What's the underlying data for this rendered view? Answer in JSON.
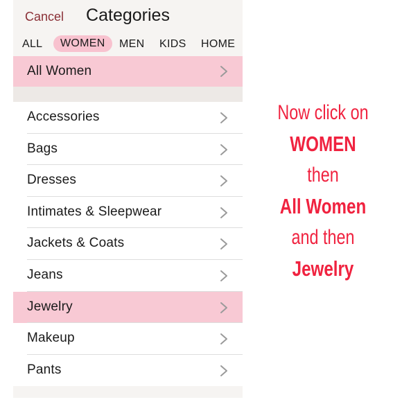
{
  "header": {
    "cancel_label": "Cancel",
    "title": "Categories"
  },
  "tabs": [
    {
      "label": "ALL",
      "selected": false
    },
    {
      "label": "WOMEN",
      "selected": true
    },
    {
      "label": "MEN",
      "selected": false
    },
    {
      "label": "KIDS",
      "selected": false
    },
    {
      "label": "HOME",
      "selected": false
    }
  ],
  "all_women": {
    "label": "All Women",
    "highlighted": true
  },
  "categories": [
    {
      "label": "Accessories"
    },
    {
      "label": "Bags"
    },
    {
      "label": "Dresses"
    },
    {
      "label": "Intimates & Sleepwear"
    },
    {
      "label": "Jackets & Coats"
    },
    {
      "label": "Jeans"
    },
    {
      "label": "Jewelry",
      "highlighted": true
    },
    {
      "label": "Makeup"
    },
    {
      "label": "Pants"
    }
  ],
  "instructions": [
    {
      "text": "Now click on",
      "bold": false
    },
    {
      "text": "WOMEN",
      "bold": true
    },
    {
      "text": "then",
      "bold": false
    },
    {
      "text": "All Women",
      "bold": true
    },
    {
      "text": "and then",
      "bold": false
    },
    {
      "text": "Jewelry",
      "bold": true
    }
  ],
  "colors": {
    "highlight": "#f8c9d4",
    "instruction_text": "#f0223f",
    "cancel_text": "#8a2f36"
  },
  "icons": {
    "row_chevron": "chevron-right-icon"
  }
}
